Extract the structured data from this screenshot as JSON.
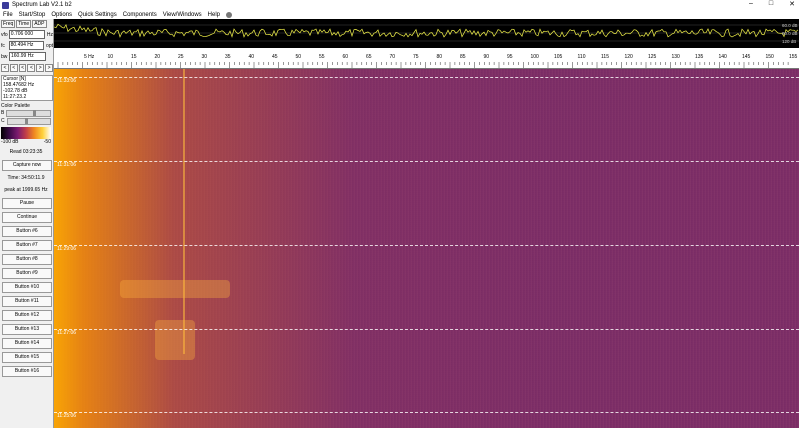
{
  "app": {
    "title": "Spectrum Lab V2.1 b2",
    "window_buttons": [
      "–",
      "□",
      "✕"
    ]
  },
  "menu": [
    "File",
    "Start/Stop",
    "Options",
    "Quick Settings",
    "Components",
    "View/Windows",
    "Help"
  ],
  "left": {
    "tabs": [
      "Freq",
      "Time",
      "ADP"
    ],
    "fields": [
      {
        "label": "vfo",
        "value": "0.706 000",
        "unit": "Hz"
      },
      {
        "label": "fc",
        "value": "80.494 Hz",
        "unit": "opt"
      },
      {
        "label": "bw",
        "value": "160.99 Hz",
        "unit": ""
      }
    ],
    "nav": [
      "<",
      "<",
      "<",
      "<",
      ">",
      ">",
      ">",
      ">"
    ],
    "cursor": {
      "title": "Cursor [N]",
      "lines": [
        "158.47682 Hz",
        "-102.78 dB",
        "11:27:23.2"
      ]
    },
    "palette": {
      "title": "Color Palette",
      "row_b": "B",
      "row_c": "C",
      "min": "-100 dB",
      "max": "-50"
    },
    "read_time": "Read 03:23:35",
    "capture": "Capture now",
    "time_label": "Time: 34:50:11.9",
    "peak": "peak at 1999.65 Hz",
    "pause": "Pause",
    "continue": "Continue",
    "buttons": [
      "Button #6",
      "Button #7",
      "Button #8",
      "Button #9",
      "Button #10",
      "Button #11",
      "Button #12",
      "Button #13",
      "Button #14",
      "Button #15",
      "Button #16"
    ]
  },
  "spectrum": {
    "db_labels": [
      "60.0 dB",
      "90.0 dB",
      "120 dB"
    ]
  },
  "axis": {
    "ticks": [
      "5 Hz",
      "10",
      "15",
      "20",
      "25",
      "30",
      "35",
      "40",
      "45",
      "50",
      "55",
      "60",
      "65",
      "70",
      "75",
      "80",
      "85",
      "90",
      "95",
      "100",
      "105",
      "110",
      "115",
      "120",
      "125",
      "130",
      "135",
      "140",
      "145",
      "150",
      "155"
    ]
  },
  "waterfall": {
    "timestamps": [
      "11:33:06",
      "11:31:06",
      "11:29:06",
      "11:27:06",
      "11:25:06"
    ]
  },
  "colors": {
    "waterfall_bg": "#7e2a6c",
    "accent": "#ffaa00",
    "trace": "#f2f24a"
  }
}
